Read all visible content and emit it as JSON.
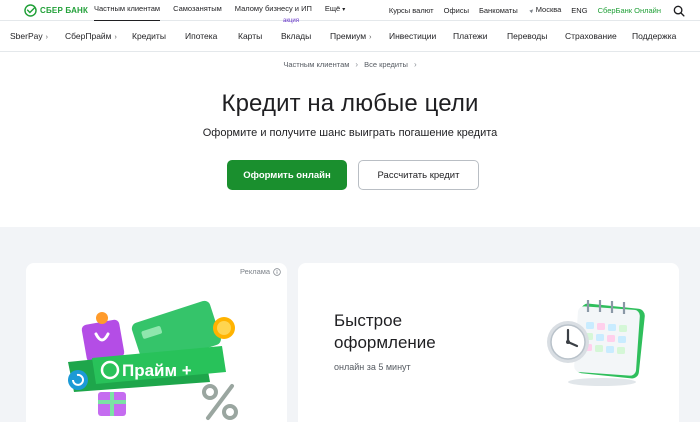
{
  "brand": {
    "name": "СБЕР БАНК",
    "accent": "#21a038",
    "button_green": "#1a8f2e"
  },
  "topbar": {
    "left_items": [
      "Частным клиентам",
      "Самозанятым",
      "Малому бизнесу и ИП",
      "Ещё"
    ],
    "active_index": 0,
    "right_items": {
      "rates": "Курсы валют",
      "offices": "Офисы",
      "atms": "Банкоматы",
      "city": "Москва",
      "lang": "ENG",
      "online": "СберБанк Онлайн"
    }
  },
  "mainnav": {
    "items": [
      {
        "label": "SberPay",
        "chevron": true
      },
      {
        "label": "СберПрайм",
        "chevron": true
      },
      {
        "label": "Кредиты",
        "chevron": false
      },
      {
        "label": "Ипотека",
        "chevron": false
      },
      {
        "label": "Карты",
        "chevron": false
      },
      {
        "label": "Вклады",
        "chevron": false
      },
      {
        "label": "Премиум",
        "chevron": true
      },
      {
        "label": "Инвестиции",
        "chevron": false
      },
      {
        "label": "Платежи",
        "chevron": false
      },
      {
        "label": "Переводы",
        "chevron": false
      },
      {
        "label": "Страхование",
        "chevron": false
      },
      {
        "label": "Поддержка",
        "chevron": false
      }
    ],
    "deposits_badge": "акция"
  },
  "breadcrumbs": {
    "items": [
      "Частным клиентам",
      "Все кредиты"
    ]
  },
  "hero": {
    "title": "Кредит на любые цели",
    "subtitle": "Оформите и получите шанс выиграть погашение кредита",
    "primary_button": "Оформить онлайн",
    "secondary_button": "Рассчитать кредит"
  },
  "cards": {
    "ad": {
      "label": "Реклама",
      "promo_text": "Прайм +",
      "promo_icon": "sber-prime-promo-illustration"
    },
    "fast": {
      "title_line1": "Быстрое",
      "title_line2": "оформление",
      "subtitle": "онлайн за 5 минут",
      "illustration": "calendar-clock-illustration"
    }
  },
  "icons": {
    "search": "search-icon",
    "info": "info-icon",
    "location": "location-arrow-icon",
    "logo": "sber-logo-icon"
  }
}
